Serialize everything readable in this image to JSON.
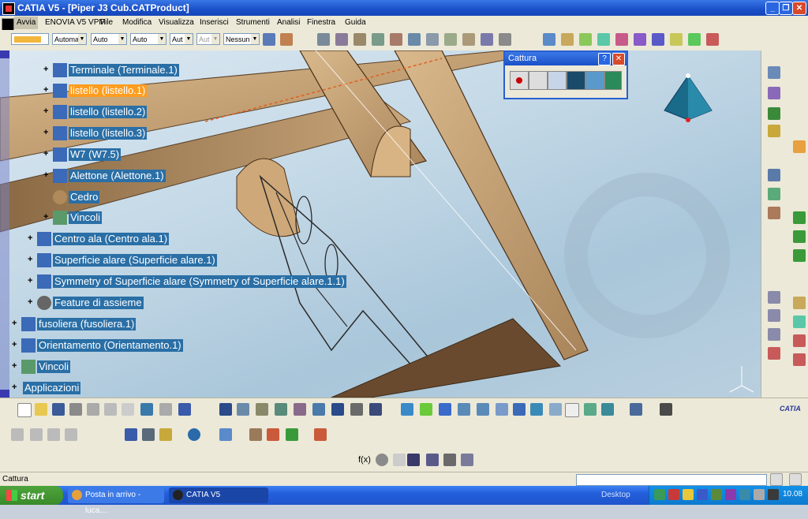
{
  "window": {
    "title": "CATIA V5 - [Piper J3 Cub.CATProduct]",
    "min": "_",
    "max": "❐",
    "close": "✕"
  },
  "menu": [
    "Avvia",
    "ENOVIA V5 VPM",
    "File",
    "Modifica",
    "Visualizza",
    "Inserisci",
    "Strumenti",
    "Analisi",
    "Finestra",
    "Guida"
  ],
  "toolbar1": {
    "dropdowns": [
      "Automa",
      "Auto",
      "Auto",
      "Aut",
      "Aut",
      "Nessun"
    ],
    "swatch_color": "#f2b63c"
  },
  "tree": [
    {
      "label": "Terminale (Terminale.1)",
      "selected": false,
      "level": 2
    },
    {
      "label": "listello (listello.1)",
      "selected": true,
      "level": 2
    },
    {
      "label": "listello (listello.2)",
      "selected": false,
      "level": 2
    },
    {
      "label": "listello (listello.3)",
      "selected": false,
      "level": 2
    },
    {
      "label": "W7 (W7.5)",
      "selected": false,
      "level": 2
    },
    {
      "label": "Alettone (Alettone.1)",
      "selected": false,
      "level": 2
    },
    {
      "label": "Cedro",
      "selected": false,
      "level": 2
    },
    {
      "label": "Vincoli",
      "selected": false,
      "level": 2
    },
    {
      "label": "Centro ala (Centro ala.1)",
      "selected": false,
      "level": 1
    },
    {
      "label": "Superficie alare (Superficie alare.1)",
      "selected": false,
      "level": 1
    },
    {
      "label": "Symmetry of Superficie alare (Symmetry of Superficie alare.1.1)",
      "selected": false,
      "level": 1
    },
    {
      "label": "Feature di assieme",
      "selected": false,
      "level": 1
    },
    {
      "label": "fusoliera (fusoliera.1)",
      "selected": false,
      "level": 0
    },
    {
      "label": "Orientamento (Orientamento.1)",
      "selected": false,
      "level": 0
    },
    {
      "label": "Vincoli",
      "selected": false,
      "level": 0
    },
    {
      "label": "Applicazioni",
      "selected": false,
      "level": 0
    }
  ],
  "cattura": {
    "title": "Cattura",
    "help": "?",
    "close": "✕"
  },
  "status": {
    "text": "Cattura"
  },
  "taskbar": {
    "start": "start",
    "tasks": [
      "Posta in arrivo - luca....",
      "CATIA V5"
    ],
    "desktop": "Desktop",
    "clock": "10.08"
  },
  "colors": {
    "tree_label_bg": "#2a6fa6",
    "tree_selected_bg": "#ff9d1f",
    "titlebar": "#1a4fc8"
  },
  "logo": "CATIA"
}
